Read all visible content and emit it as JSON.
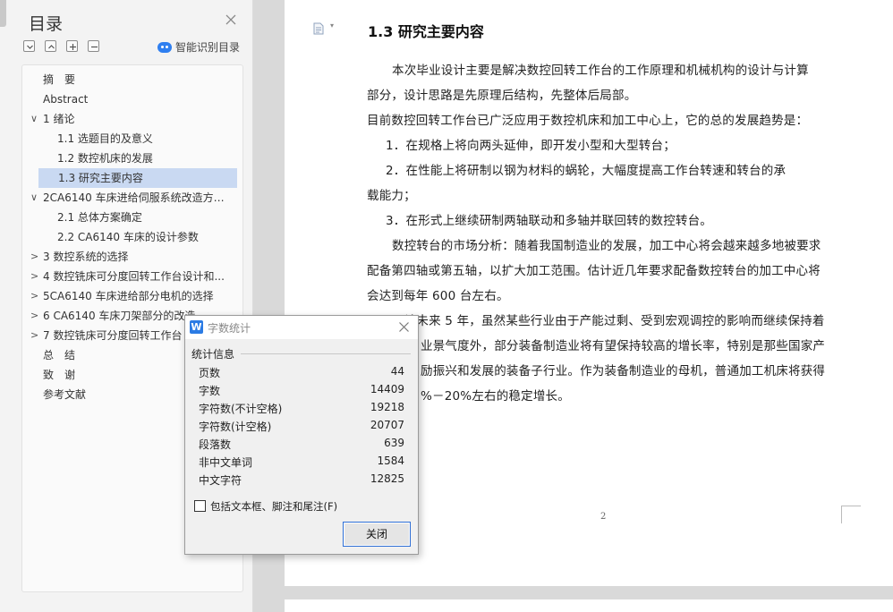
{
  "toc": {
    "title": "目录",
    "smart_label": "智能识别目录",
    "items": [
      {
        "label": "摘　要"
      },
      {
        "label": "Abstract"
      },
      {
        "label": "1 绪论"
      },
      {
        "label": "1.1 选题目的及意义"
      },
      {
        "label": "1.2 数控机床的发展"
      },
      {
        "label": "1.3 研究主要内容"
      },
      {
        "label": "2CA6140 车床进给伺服系统改造方案..."
      },
      {
        "label": "2.1 总体方案确定"
      },
      {
        "label": "2.2 CA6140 车床的设计参数"
      },
      {
        "label": "3 数控系统的选择"
      },
      {
        "label": "4 数控铣床可分度回转工作台设计和..."
      },
      {
        "label": "5CA6140 车床进给部分电机的选择"
      },
      {
        "label": "6 CA6140 车床刀架部分的改造"
      },
      {
        "label": "7 数控铣床可分度回转工作台"
      },
      {
        "label": "总　结"
      },
      {
        "label": "致　谢"
      },
      {
        "label": "参考文献"
      }
    ]
  },
  "doc": {
    "heading": "1.3 研究主要内容",
    "lines": [
      "本次毕业设计主要是解决数控回转工作台的工作原理和机械机构的设计与计算",
      "部分，设计思路是先原理后结构，先整体后局部。",
      "目前数控回转工作台已广泛应用于数控机床和加工中心上，它的总的发展趋势是：",
      "1．在规格上将向两头延伸，即开发小型和大型转台；",
      "2．在性能上将研制以钢为材料的蜗轮，大幅度提高工作台转速和转台的承",
      "载能力；",
      "3．在形式上继续研制两轴联动和多轴并联回转的数控转台。",
      "数控转台的市场分析：随着我国制造业的发展，加工中心将会越来越多地被要求",
      "配备第四轴或第五轴，以扩大加工范围。估计近几年要求配备数控转台的加工中心将",
      "会达到每年 600 台左右。",
      "预计未来 5 年，虽然某些行业由于产能过剩、受到宏观调控的影响而继续保持着",
      "业景气度外，部分装备制造业将有望保持较高的增长率，特别是那些国家产",
      "励振兴和发展的装备子行业。作为装备制造业的母机，普通加工机床将获得",
      "%－20%左右的稳定增长。"
    ],
    "page_number": "2"
  },
  "dialog": {
    "title": "字数统计",
    "section": "统计信息",
    "stats": [
      {
        "label": "页数",
        "value": "44"
      },
      {
        "label": "字数",
        "value": "14409"
      },
      {
        "label": "字符数(不计空格)",
        "value": "19218"
      },
      {
        "label": "字符数(计空格)",
        "value": "20707"
      },
      {
        "label": "段落数",
        "value": "639"
      },
      {
        "label": "非中文单词",
        "value": "1584"
      },
      {
        "label": "中文字符",
        "value": "12825"
      }
    ],
    "checkbox_label": "包括文本框、脚注和尾注(F)",
    "checkbox_checked": false,
    "close_label": "关闭",
    "app_icon": "W"
  },
  "icons": {
    "toc_close": "close-icon",
    "collapse_all": "collapse-icon",
    "expand_all": "expand-icon",
    "add": "plus-icon",
    "remove": "minus-icon",
    "smart": "robot-icon",
    "doc": "document-icon"
  },
  "colors": {
    "selection": "#c9d9f2",
    "accent": "#2f6fd6",
    "app_icon": "#2b7be4"
  }
}
